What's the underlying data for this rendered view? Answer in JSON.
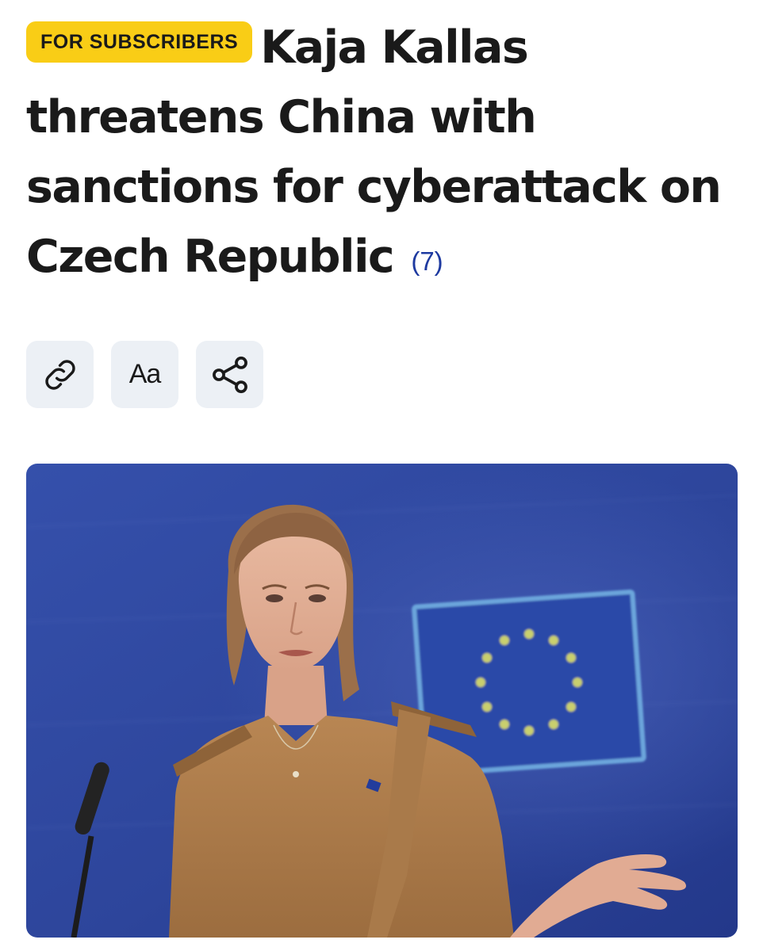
{
  "article": {
    "badge_label": "FOR SUBSCRIBERS",
    "title": "Kaja Kallas threatens China with sanctions for cyberattack on Czech Republic",
    "comment_count": "(7)"
  },
  "toolbar": {
    "icons": [
      "link-icon",
      "font-size-icon",
      "share-icon"
    ],
    "font_label": "Aa"
  },
  "colors": {
    "badge_bg": "#f9cd16",
    "comment_link": "#1e3aa0",
    "button_bg": "#ecf0f5",
    "photo_backdrop": "#2f4aa0"
  }
}
